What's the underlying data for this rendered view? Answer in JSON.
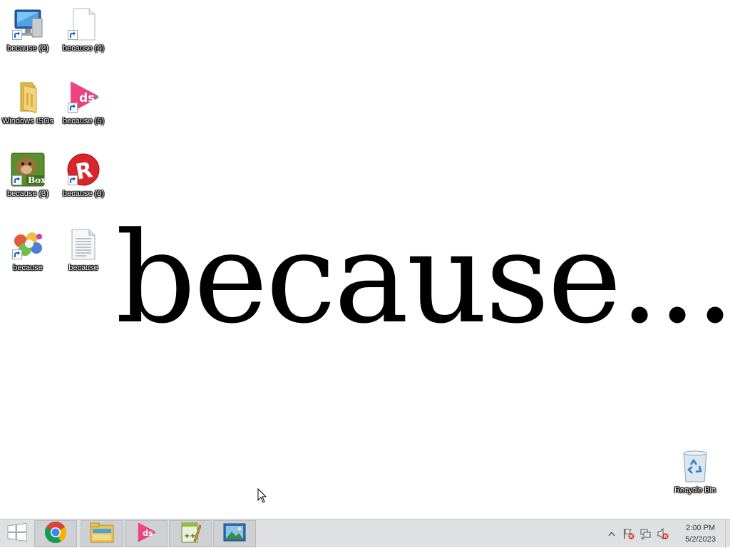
{
  "desktop": {
    "wallpaper_text": "because...",
    "icons": [
      {
        "label": "because (2)",
        "icon": "computer-icon"
      },
      {
        "label": "because (4)",
        "icon": "blank-document-icon"
      },
      {
        "label": "Windows ISOs",
        "icon": "folder-icon"
      },
      {
        "label": "because (5)",
        "icon": "ds-app-icon"
      },
      {
        "label": "because (3)",
        "icon": "box-game-icon"
      },
      {
        "label": "because (3)",
        "icon": "roblox-icon"
      },
      {
        "label": "because",
        "icon": "game-collage-icon"
      },
      {
        "label": "because",
        "icon": "text-document-icon"
      },
      {
        "label": "Recycle Bin",
        "icon": "recycle-bin-icon"
      }
    ]
  },
  "taskbar": {
    "start_icon": "windows-logo-icon",
    "pinned": [
      {
        "name": "chrome",
        "icon": "chrome-icon"
      },
      {
        "name": "file-explorer",
        "icon": "file-explorer-icon"
      },
      {
        "name": "ds-app",
        "icon": "ds-app-icon"
      },
      {
        "name": "notepad-plus-plus",
        "icon": "notepad-plus-plus-icon"
      },
      {
        "name": "photo-viewer",
        "icon": "photo-viewer-icon"
      }
    ],
    "tray": {
      "icons": [
        "show-hidden-icons-icon",
        "action-center-flag-icon",
        "network-icon",
        "volume-muted-icon"
      ],
      "time": "2:00 PM",
      "date": "5/2/2023"
    }
  },
  "colors": {
    "taskbar_bg": "#dfe0e2",
    "desktop_bg": "#ffffff",
    "chrome_red": "#db4437",
    "chrome_green": "#0f9d58",
    "chrome_yellow": "#f4b400",
    "chrome_blue": "#4285f4",
    "ds_pink": "#e9407a",
    "ds_blue": "#3fb6e8"
  }
}
